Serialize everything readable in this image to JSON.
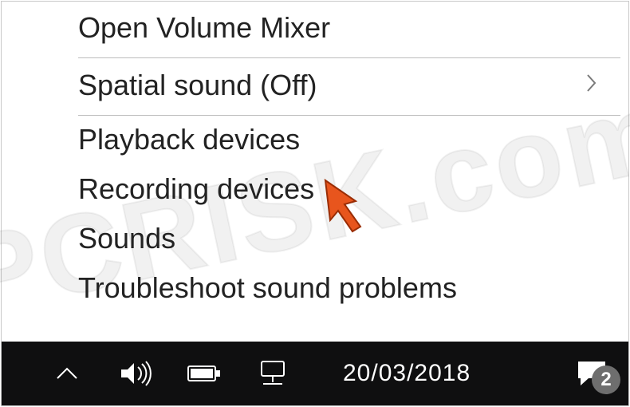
{
  "menu": {
    "items": [
      {
        "label": "Open Volume Mixer",
        "submenu": false
      },
      {
        "label": "Spatial sound (Off)",
        "submenu": true
      },
      {
        "label": "Playback devices",
        "submenu": false
      },
      {
        "label": "Recording devices",
        "submenu": false
      },
      {
        "label": "Sounds",
        "submenu": false
      },
      {
        "label": "Troubleshoot sound problems",
        "submenu": false
      }
    ]
  },
  "taskbar": {
    "date": "20/03/2018",
    "notification_count": "2"
  },
  "watermark": "PCRISK.com"
}
